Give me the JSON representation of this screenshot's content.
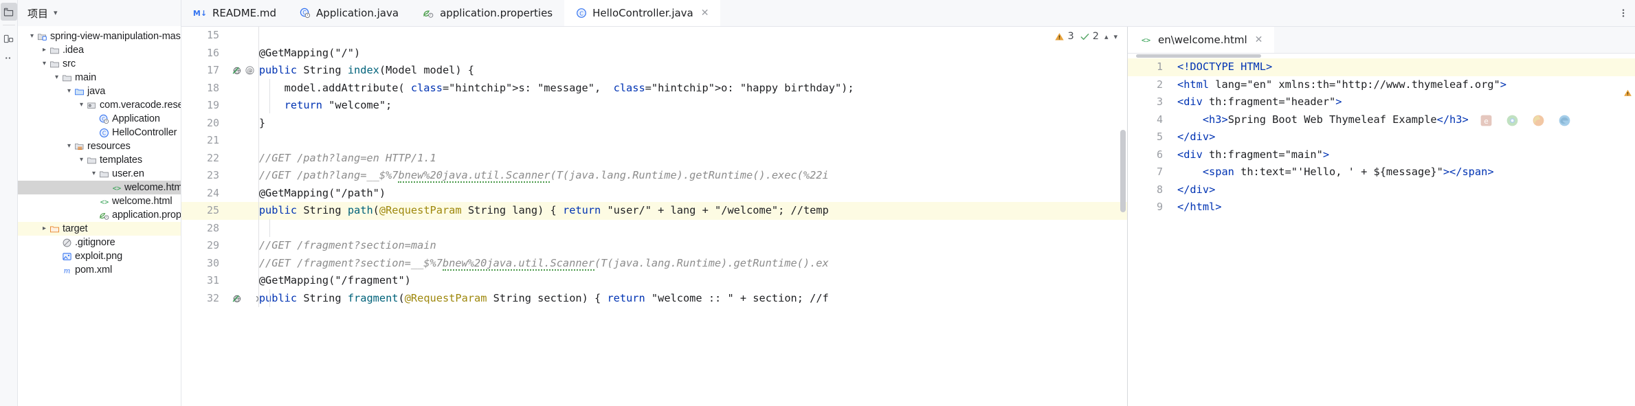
{
  "project_panel": {
    "title": "项目",
    "tree": [
      {
        "label": "spring-view-manipulation-master",
        "indent": 0,
        "twisty": "v",
        "icon": "module-folder-icon",
        "state": "normal"
      },
      {
        "label": ".idea",
        "indent": 1,
        "twisty": ">",
        "icon": "folder-icon",
        "state": "normal"
      },
      {
        "label": "src",
        "indent": 1,
        "twisty": "v",
        "icon": "folder-icon",
        "state": "normal"
      },
      {
        "label": "main",
        "indent": 2,
        "twisty": "v",
        "icon": "folder-icon",
        "state": "normal"
      },
      {
        "label": "java",
        "indent": 3,
        "twisty": "v",
        "icon": "source-folder-icon",
        "state": "normal"
      },
      {
        "label": "com.veracode.research",
        "indent": 4,
        "twisty": "v",
        "icon": "package-icon",
        "state": "normal"
      },
      {
        "label": "Application",
        "indent": 5,
        "twisty": "",
        "icon": "java-runnable-class-icon",
        "state": "normal"
      },
      {
        "label": "HelloController",
        "indent": 5,
        "twisty": "",
        "icon": "java-class-icon",
        "state": "normal"
      },
      {
        "label": "resources",
        "indent": 3,
        "twisty": "v",
        "icon": "resources-folder-icon",
        "state": "normal"
      },
      {
        "label": "templates",
        "indent": 4,
        "twisty": "v",
        "icon": "folder-icon",
        "state": "normal"
      },
      {
        "label": "user.en",
        "indent": 5,
        "twisty": "v",
        "icon": "folder-icon",
        "state": "normal"
      },
      {
        "label": "welcome.html",
        "indent": 6,
        "twisty": "",
        "icon": "html-icon",
        "state": "selected"
      },
      {
        "label": "welcome.html",
        "indent": 5,
        "twisty": "",
        "icon": "html-icon",
        "state": "normal"
      },
      {
        "label": "application.properties",
        "indent": 5,
        "twisty": "",
        "icon": "spring-properties-icon",
        "state": "normal"
      },
      {
        "label": "target",
        "indent": 1,
        "twisty": ">",
        "icon": "excluded-folder-icon",
        "state": "highlight"
      },
      {
        "label": ".gitignore",
        "indent": 2,
        "twisty": "",
        "icon": "gitignore-icon",
        "state": "normal"
      },
      {
        "label": "exploit.png",
        "indent": 2,
        "twisty": "",
        "icon": "image-icon",
        "state": "normal"
      },
      {
        "label": "pom.xml",
        "indent": 2,
        "twisty": "",
        "icon": "maven-icon",
        "state": "normal"
      }
    ]
  },
  "editor_tabs": [
    {
      "label": "README.md",
      "icon": "markdown-icon",
      "active": false,
      "closable": false
    },
    {
      "label": "Application.java",
      "icon": "java-runnable-class-icon",
      "active": false,
      "closable": false
    },
    {
      "label": "application.properties",
      "icon": "spring-properties-icon",
      "active": false,
      "closable": false
    },
    {
      "label": "HelloController.java",
      "icon": "java-class-icon",
      "active": true,
      "closable": true
    }
  ],
  "tab_overflow_icon": "more-vertical-icon",
  "inspection_widget": {
    "warning_icon": "warning-triangle-icon",
    "warning_count": "3",
    "check_icon": "inspection-check-icon",
    "check_count": "2",
    "prev_icon": "chevron-up-icon",
    "next_icon": "chevron-down-icon"
  },
  "code_editor": {
    "language": "java",
    "lines": [
      {
        "n": "15",
        "text": "",
        "gutter_icons": []
      },
      {
        "n": "16",
        "text": "    @GetMapping(\"/\")",
        "gutter_icons": []
      },
      {
        "n": "17",
        "text": "    public String index(Model model) {",
        "gutter_icons": [
          "web-mapping-icon",
          "annotation-icon"
        ]
      },
      {
        "n": "18",
        "text": "        model.addAttribute( s: \"message\",  o: \"happy birthday\");",
        "gutter_icons": []
      },
      {
        "n": "19",
        "text": "        return \"welcome\";",
        "gutter_icons": []
      },
      {
        "n": "20",
        "text": "    }",
        "gutter_icons": []
      },
      {
        "n": "21",
        "text": "",
        "gutter_icons": []
      },
      {
        "n": "22",
        "text": "    //GET /path?lang=en HTTP/1.1",
        "gutter_icons": []
      },
      {
        "n": "23",
        "text": "    //GET /path?lang=__$%7bnew%20java.util.Scanner(T(java.lang.Runtime).getRuntime().exec(%22i",
        "gutter_icons": []
      },
      {
        "n": "24",
        "text": "    @GetMapping(\"/path\")",
        "gutter_icons": []
      },
      {
        "n": "25",
        "text": "    public String path(@RequestParam String lang) { return \"user/\" + lang + \"/welcome\"; //temp",
        "gutter_icons": [
          "web-mapping-icon"
        ]
      },
      {
        "n": "28",
        "text": "",
        "gutter_icons": []
      },
      {
        "n": "29",
        "text": "    //GET /fragment?section=main",
        "gutter_icons": []
      },
      {
        "n": "30",
        "text": "    //GET /fragment?section=__$%7bnew%20java.util.Scanner(T(java.lang.Runtime).getRuntime().ex",
        "gutter_icons": []
      },
      {
        "n": "31",
        "text": "    @GetMapping(\"/fragment\")",
        "gutter_icons": []
      },
      {
        "n": "32",
        "text": "    public String fragment(@RequestParam String section) { return \"welcome :: \" + section; //f",
        "gutter_icons": [
          "web-mapping-icon"
        ]
      }
    ]
  },
  "html_pane": {
    "tab": {
      "label": "en\\welcome.html",
      "icon": "html-icon",
      "active": true,
      "closable": true
    },
    "lines": [
      {
        "n": "1",
        "text": "<!DOCTYPE HTML>"
      },
      {
        "n": "2",
        "text": "<html lang=\"en\" xmlns:th=\"http://www.thymeleaf.org\">"
      },
      {
        "n": "3",
        "text": "<div th:fragment=\"header\">"
      },
      {
        "n": "4",
        "text": "    <h3>Spring Boot Web Thymeleaf Example</h3>"
      },
      {
        "n": "5",
        "text": "</div>"
      },
      {
        "n": "6",
        "text": "<div th:fragment=\"main\">"
      },
      {
        "n": "7",
        "text": "    <span th:text=\"'Hello, ' + ${message}\"></span>"
      },
      {
        "n": "8",
        "text": "</div>"
      },
      {
        "n": "9",
        "text": "</html>"
      }
    ],
    "browser_icons": [
      "ie-browser-icon",
      "chrome-browser-icon",
      "firefox-browser-icon",
      "edge-browser-icon"
    ]
  },
  "colors": {
    "accent_blue": "#3574f0",
    "keyword": "#0033b3",
    "string": "#067d17",
    "comment": "#8c8c8c",
    "annotation": "#9e880d",
    "method": "#00627a",
    "attribute": "#9b4dca",
    "selection_gray": "#d4d4d4",
    "highlight_yellow": "#fdfbe3",
    "panel_bg": "#f7f8fa",
    "warning_orange": "#e8a33d",
    "check_green": "#59a869"
  }
}
